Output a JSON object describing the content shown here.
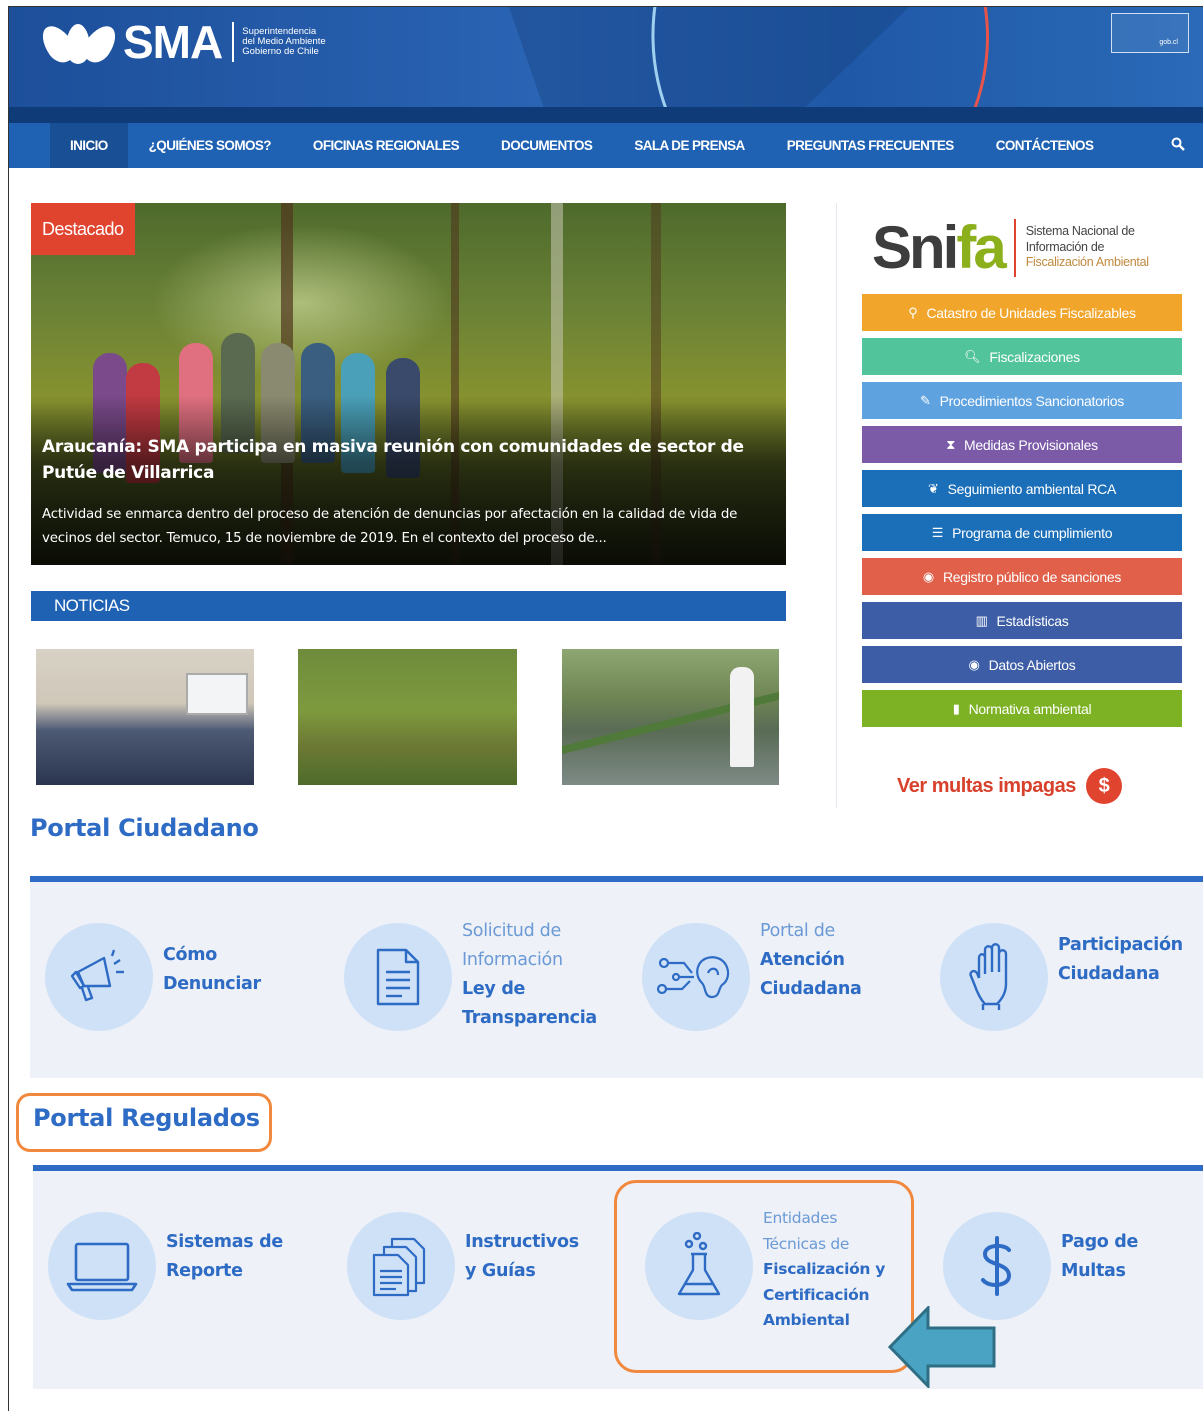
{
  "header": {
    "logo_text": "SMA",
    "logo_sub": [
      "Superintendencia",
      "del Medio Ambiente",
      "Gobierno de Chile"
    ],
    "gob_label": "gob.cl"
  },
  "nav": {
    "items": [
      "INICIO",
      "¿QUIÉNES SOMOS?",
      "OFICINAS REGIONALES",
      "DOCUMENTOS",
      "SALA DE PRENSA",
      "PREGUNTAS FRECUENTES",
      "CONTÁCTENOS"
    ],
    "active_index": 0
  },
  "featured": {
    "badge": "Destacado",
    "title": "Araucanía: SMA participa en masiva reunión con comunidades de sector de Putúe de Villarrica",
    "description": "Actividad se enmarca dentro del proceso de atención de denuncias por afectación en la calidad de vida de vecinos del sector. Temuco, 15 de noviembre de 2019. En el contexto del proceso de..."
  },
  "noticias": {
    "heading": "NOTICIAS"
  },
  "snifa": {
    "word_a": "Sni",
    "word_b": "fa",
    "sub": [
      "Sistema Nacional de",
      "Información de",
      "Fiscalización Ambiental"
    ],
    "buttons": [
      {
        "label": "Catastro de Unidades Fiscalizables",
        "color": "#f2a52b",
        "icon": "map-pin-icon",
        "glyph": "⚲"
      },
      {
        "label": "Fiscalizaciones",
        "color": "#52c49b",
        "icon": "search-icon",
        "glyph": "🔍︎"
      },
      {
        "label": "Procedimientos Sancionatorios",
        "color": "#5ea2e0",
        "icon": "gavel-icon",
        "glyph": "✎"
      },
      {
        "label": "Medidas Provisionales",
        "color": "#7b5aa8",
        "icon": "hourglass-icon",
        "glyph": "⧗"
      },
      {
        "label": "Seguimiento ambiental RCA",
        "color": "#1b6fb8",
        "icon": "leaf-icon",
        "glyph": "❦"
      },
      {
        "label": "Programa de cumplimiento",
        "color": "#1b6fb8",
        "icon": "list-icon",
        "glyph": "☰"
      },
      {
        "label": "Registro público de sanciones",
        "color": "#e0604a",
        "icon": "eye-icon",
        "glyph": "◉"
      },
      {
        "label": "Estadísticas",
        "color": "#3d5ea6",
        "icon": "chart-icon",
        "glyph": "▥"
      },
      {
        "label": "Datos Abiertos",
        "color": "#3d5ea6",
        "icon": "eye-icon",
        "glyph": "◉"
      },
      {
        "label": "Normativa ambiental",
        "color": "#7cb223",
        "icon": "book-icon",
        "glyph": "▮"
      }
    ],
    "multas": "Ver multas impagas",
    "multas_symbol": "$"
  },
  "portal_ciudadano": {
    "title": "Portal Ciudadano",
    "cards": [
      {
        "light": [],
        "bold": [
          "Cómo",
          "Denunciar"
        ],
        "icon": "megaphone-icon"
      },
      {
        "light": [
          "Solicitud de",
          "Información"
        ],
        "bold": [
          "Ley de",
          "Transparencia"
        ],
        "icon": "document-icon"
      },
      {
        "light": [
          "Portal de"
        ],
        "bold": [
          "Atención",
          "Ciudadana"
        ],
        "icon": "ear-icon"
      },
      {
        "light": [],
        "bold": [
          "Participación",
          "Ciudadana"
        ],
        "icon": "raised-hand-icon"
      }
    ]
  },
  "portal_regulados": {
    "title": "Portal Regulados",
    "cards": [
      {
        "light": [],
        "bold": [
          "Sistemas de",
          "Reporte"
        ],
        "icon": "laptop-icon"
      },
      {
        "light": [],
        "bold": [
          "Instructivos",
          "y Guías"
        ],
        "icon": "documents-icon"
      },
      {
        "light": [
          "Entidades",
          "Técnicas de"
        ],
        "bold": [
          "Fiscalización y",
          "Certificación",
          "Ambiental"
        ],
        "icon": "flask-icon"
      },
      {
        "light": [],
        "bold": [
          "Pago de",
          "Multas"
        ],
        "icon": "dollar-icon"
      }
    ]
  }
}
